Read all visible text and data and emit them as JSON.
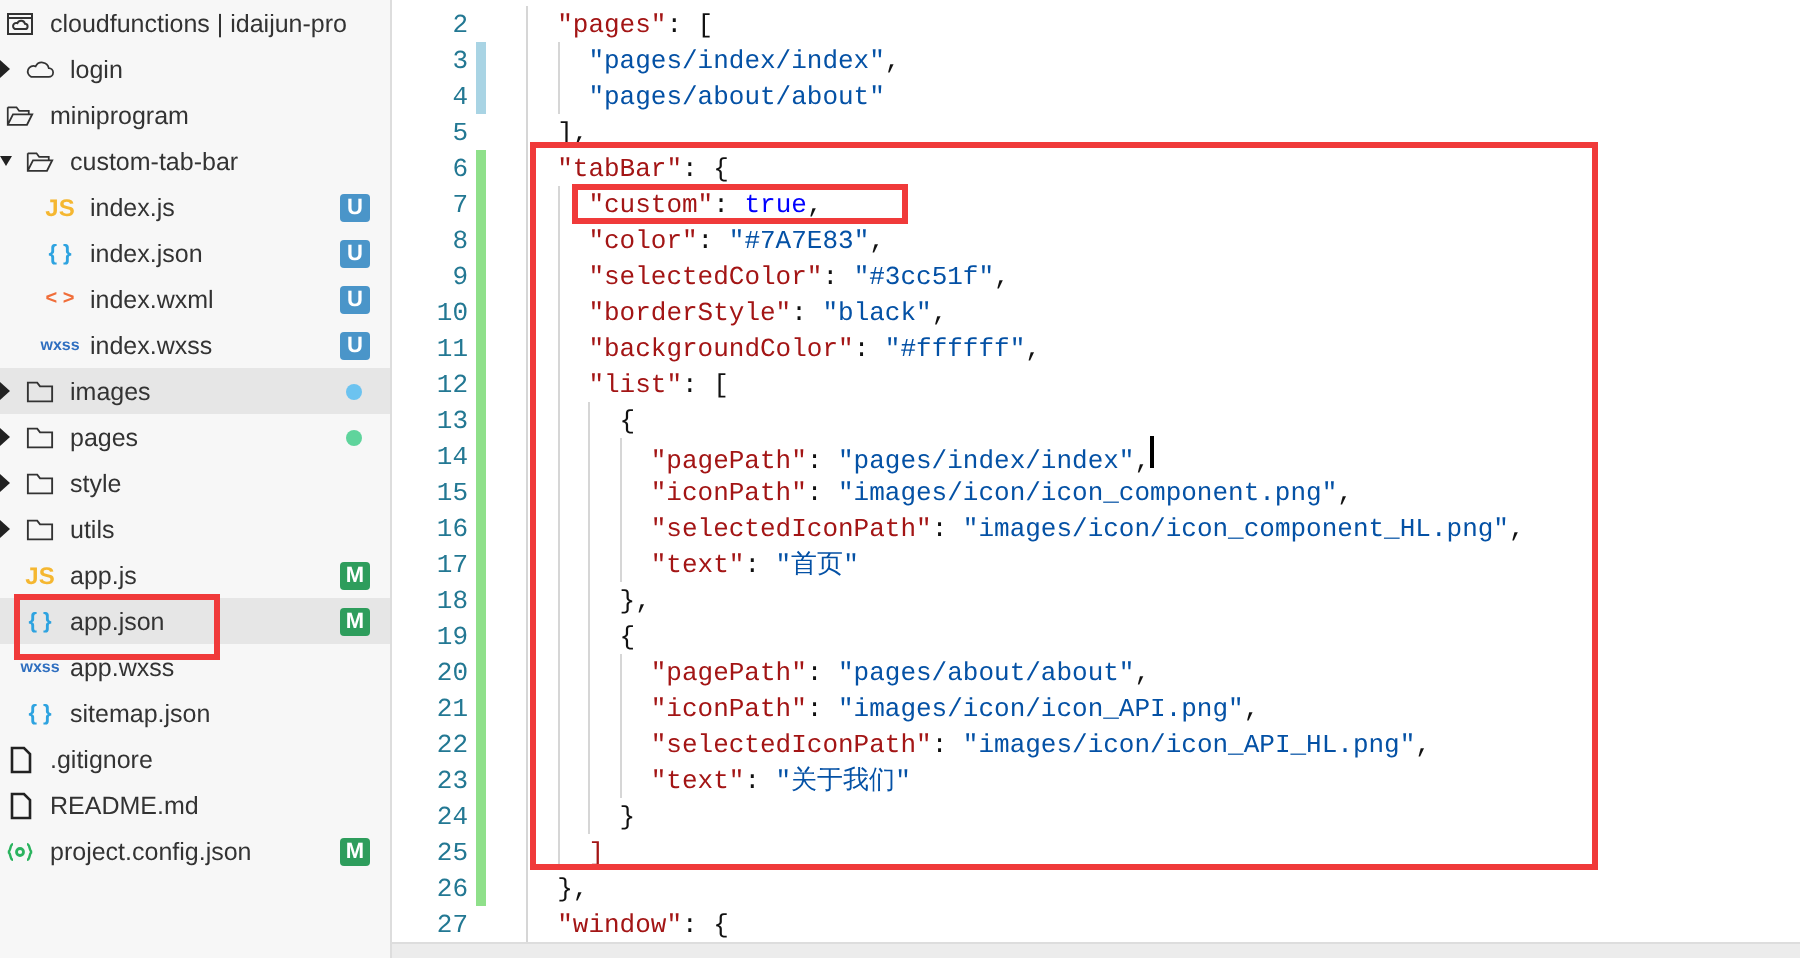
{
  "sidebar": {
    "items": [
      {
        "label": "cloudfunctions | idaijun-pro",
        "icon": {
          "kind": "cloud-folder"
        },
        "selected": false,
        "children": [
          {
            "label": "login",
            "icon": {
              "kind": "cloud"
            },
            "expanded": false,
            "selected": false
          }
        ]
      },
      {
        "label": "miniprogram",
        "icon": {
          "kind": "folder-open"
        },
        "selected": false,
        "children": [
          {
            "label": "custom-tab-bar",
            "icon": {
              "kind": "folder-open"
            },
            "expanded": true,
            "selected": false,
            "children": [
              {
                "label": "index.js",
                "icon": {
                  "kind": "js",
                  "text": "JS"
                },
                "selected": false,
                "status": {
                  "kind": "letter",
                  "text": "U",
                  "color": "#4a95c9"
                }
              },
              {
                "label": "index.json",
                "icon": {
                  "kind": "json",
                  "text": "{ }"
                },
                "selected": false,
                "status": {
                  "kind": "letter",
                  "text": "U",
                  "color": "#4a95c9"
                }
              },
              {
                "label": "index.wxml",
                "icon": {
                  "kind": "wxml",
                  "text": "< >"
                },
                "selected": false,
                "status": {
                  "kind": "letter",
                  "text": "U",
                  "color": "#4a95c9"
                }
              },
              {
                "label": "index.wxss",
                "icon": {
                  "kind": "wxss",
                  "text": "wxss"
                },
                "selected": false,
                "status": {
                  "kind": "letter",
                  "text": "U",
                  "color": "#4a95c9"
                }
              }
            ]
          },
          {
            "label": "images",
            "icon": {
              "kind": "folder"
            },
            "expanded": false,
            "selected": true,
            "status": {
              "kind": "dot",
              "color": "#6cc3f0"
            }
          },
          {
            "label": "pages",
            "icon": {
              "kind": "folder"
            },
            "expanded": false,
            "selected": false,
            "status": {
              "kind": "dot",
              "color": "#5fd49c"
            }
          },
          {
            "label": "style",
            "icon": {
              "kind": "folder"
            },
            "expanded": false,
            "selected": false
          },
          {
            "label": "utils",
            "icon": {
              "kind": "folder"
            },
            "expanded": false,
            "selected": false
          },
          {
            "label": "app.js",
            "icon": {
              "kind": "js",
              "text": "JS"
            },
            "selected": false,
            "status": {
              "kind": "letter",
              "text": "M",
              "color": "#2e9d5c"
            }
          },
          {
            "label": "app.json",
            "icon": {
              "kind": "json",
              "text": "{ }"
            },
            "selected": true,
            "marked": true,
            "status": {
              "kind": "letter",
              "text": "M",
              "color": "#2e9d5c"
            }
          },
          {
            "label": "app.wxss",
            "icon": {
              "kind": "wxss",
              "text": "wxss"
            },
            "selected": false
          },
          {
            "label": "sitemap.json",
            "icon": {
              "kind": "json",
              "text": "{ }"
            },
            "selected": false
          }
        ]
      },
      {
        "label": ".gitignore",
        "icon": {
          "kind": "file"
        },
        "selected": false
      },
      {
        "label": "README.md",
        "icon": {
          "kind": "file"
        },
        "selected": false
      },
      {
        "label": "project.config.json",
        "icon": {
          "kind": "config"
        },
        "selected": false,
        "status": {
          "kind": "letter",
          "text": "M",
          "color": "#2e9d5c"
        }
      }
    ]
  },
  "editor": {
    "lines": [
      {
        "number": "2",
        "boxed": false,
        "marked": false,
        "cursor": false,
        "tokens": [
          {
            "kind": "key",
            "text": "\"pages\""
          },
          {
            "kind": "punct",
            "text": ": ["
          }
        ],
        "children": [
          {
            "number": "3",
            "change": {
              "kind": "modified"
            },
            "boxed": false,
            "marked": false,
            "cursor": false,
            "tokens": [
              {
                "kind": "str",
                "text": "\"pages/index/index\""
              },
              {
                "kind": "punct",
                "text": ","
              }
            ]
          },
          {
            "number": "4",
            "change": {
              "kind": "modified"
            },
            "boxed": false,
            "marked": false,
            "cursor": false,
            "tokens": [
              {
                "kind": "str",
                "text": "\"pages/about/about\""
              }
            ]
          }
        ]
      },
      {
        "number": "5",
        "boxed": false,
        "marked": false,
        "cursor": false,
        "tokens": [
          {
            "kind": "punct",
            "text": "],"
          }
        ]
      },
      {
        "number": "6",
        "change": {
          "kind": "added"
        },
        "boxed": true,
        "marked": false,
        "cursor": false,
        "tokens": [
          {
            "kind": "key",
            "text": "\"tabBar\""
          },
          {
            "kind": "punct",
            "text": ": {"
          }
        ],
        "children": [
          {
            "number": "7",
            "change": {
              "kind": "added"
            },
            "boxed": false,
            "marked": true,
            "cursor": false,
            "tokens": [
              {
                "kind": "key",
                "text": "\"custom\""
              },
              {
                "kind": "punct",
                "text": ": "
              },
              {
                "kind": "kw",
                "text": "true"
              },
              {
                "kind": "punct",
                "text": ","
              }
            ]
          },
          {
            "number": "8",
            "change": {
              "kind": "added"
            },
            "boxed": false,
            "marked": false,
            "cursor": false,
            "tokens": [
              {
                "kind": "key",
                "text": "\"color\""
              },
              {
                "kind": "punct",
                "text": ": "
              },
              {
                "kind": "str",
                "text": "\"#7A7E83\""
              },
              {
                "kind": "punct",
                "text": ","
              }
            ]
          },
          {
            "number": "9",
            "change": {
              "kind": "added"
            },
            "boxed": false,
            "marked": false,
            "cursor": false,
            "tokens": [
              {
                "kind": "key",
                "text": "\"selectedColor\""
              },
              {
                "kind": "punct",
                "text": ": "
              },
              {
                "kind": "str",
                "text": "\"#3cc51f\""
              },
              {
                "kind": "punct",
                "text": ","
              }
            ]
          },
          {
            "number": "10",
            "change": {
              "kind": "added"
            },
            "boxed": false,
            "marked": false,
            "cursor": false,
            "tokens": [
              {
                "kind": "key",
                "text": "\"borderStyle\""
              },
              {
                "kind": "punct",
                "text": ": "
              },
              {
                "kind": "str",
                "text": "\"black\""
              },
              {
                "kind": "punct",
                "text": ","
              }
            ]
          },
          {
            "number": "11",
            "change": {
              "kind": "added"
            },
            "boxed": false,
            "marked": false,
            "cursor": false,
            "tokens": [
              {
                "kind": "key",
                "text": "\"backgroundColor\""
              },
              {
                "kind": "punct",
                "text": ": "
              },
              {
                "kind": "str",
                "text": "\"#ffffff\""
              },
              {
                "kind": "punct",
                "text": ","
              }
            ]
          },
          {
            "number": "12",
            "change": {
              "kind": "added"
            },
            "boxed": false,
            "marked": false,
            "cursor": false,
            "tokens": [
              {
                "kind": "key",
                "text": "\"list\""
              },
              {
                "kind": "punct",
                "text": ": ["
              }
            ],
            "children": [
              {
                "number": "13",
                "change": {
                  "kind": "added"
                },
                "boxed": false,
                "marked": false,
                "cursor": false,
                "tokens": [
                  {
                    "kind": "punct",
                    "text": "{"
                  }
                ],
                "children": [
                  {
                    "number": "14",
                    "change": {
                      "kind": "added"
                    },
                    "boxed": false,
                    "marked": false,
                    "cursor": true,
                    "tokens": [
                      {
                        "kind": "key",
                        "text": "\"pagePath\""
                      },
                      {
                        "kind": "punct",
                        "text": ": "
                      },
                      {
                        "kind": "str",
                        "text": "\"pages/index/index\""
                      },
                      {
                        "kind": "punct",
                        "text": ","
                      }
                    ]
                  },
                  {
                    "number": "15",
                    "change": {
                      "kind": "added"
                    },
                    "boxed": false,
                    "marked": false,
                    "cursor": false,
                    "tokens": [
                      {
                        "kind": "key",
                        "text": "\"iconPath\""
                      },
                      {
                        "kind": "punct",
                        "text": ": "
                      },
                      {
                        "kind": "str",
                        "text": "\"images/icon/icon_component.png\""
                      },
                      {
                        "kind": "punct",
                        "text": ","
                      }
                    ]
                  },
                  {
                    "number": "16",
                    "change": {
                      "kind": "added"
                    },
                    "boxed": false,
                    "marked": false,
                    "cursor": false,
                    "tokens": [
                      {
                        "kind": "key",
                        "text": "\"selectedIconPath\""
                      },
                      {
                        "kind": "punct",
                        "text": ": "
                      },
                      {
                        "kind": "str",
                        "text": "\"images/icon/icon_component_HL.png\""
                      },
                      {
                        "kind": "punct",
                        "text": ","
                      }
                    ]
                  },
                  {
                    "number": "17",
                    "change": {
                      "kind": "added"
                    },
                    "boxed": false,
                    "marked": false,
                    "cursor": false,
                    "tokens": [
                      {
                        "kind": "key",
                        "text": "\"text\""
                      },
                      {
                        "kind": "punct",
                        "text": ": "
                      },
                      {
                        "kind": "str",
                        "text": "\"首页\""
                      }
                    ]
                  }
                ]
              },
              {
                "number": "18",
                "change": {
                  "kind": "added"
                },
                "boxed": false,
                "marked": false,
                "cursor": false,
                "tokens": [
                  {
                    "kind": "punct",
                    "text": "},"
                  }
                ]
              },
              {
                "number": "19",
                "change": {
                  "kind": "added"
                },
                "boxed": false,
                "marked": false,
                "cursor": false,
                "tokens": [
                  {
                    "kind": "punct",
                    "text": "{"
                  }
                ],
                "children": [
                  {
                    "number": "20",
                    "change": {
                      "kind": "added"
                    },
                    "boxed": false,
                    "marked": false,
                    "cursor": false,
                    "tokens": [
                      {
                        "kind": "key",
                        "text": "\"pagePath\""
                      },
                      {
                        "kind": "punct",
                        "text": ": "
                      },
                      {
                        "kind": "str",
                        "text": "\"pages/about/about\""
                      },
                      {
                        "kind": "punct",
                        "text": ","
                      }
                    ]
                  },
                  {
                    "number": "21",
                    "change": {
                      "kind": "added"
                    },
                    "boxed": false,
                    "marked": false,
                    "cursor": false,
                    "tokens": [
                      {
                        "kind": "key",
                        "text": "\"iconPath\""
                      },
                      {
                        "kind": "punct",
                        "text": ": "
                      },
                      {
                        "kind": "str",
                        "text": "\"images/icon/icon_API.png\""
                      },
                      {
                        "kind": "punct",
                        "text": ","
                      }
                    ]
                  },
                  {
                    "number": "22",
                    "change": {
                      "kind": "added"
                    },
                    "boxed": false,
                    "marked": false,
                    "cursor": false,
                    "tokens": [
                      {
                        "kind": "key",
                        "text": "\"selectedIconPath\""
                      },
                      {
                        "kind": "punct",
                        "text": ": "
                      },
                      {
                        "kind": "str",
                        "text": "\"images/icon/icon_API_HL.png\""
                      },
                      {
                        "kind": "punct",
                        "text": ","
                      }
                    ]
                  },
                  {
                    "number": "23",
                    "change": {
                      "kind": "added"
                    },
                    "boxed": false,
                    "marked": false,
                    "cursor": false,
                    "tokens": [
                      {
                        "kind": "key",
                        "text": "\"text\""
                      },
                      {
                        "kind": "punct",
                        "text": ": "
                      },
                      {
                        "kind": "str",
                        "text": "\"关于我们\""
                      }
                    ]
                  }
                ]
              },
              {
                "number": "24",
                "change": {
                  "kind": "added"
                },
                "boxed": false,
                "marked": false,
                "cursor": false,
                "tokens": [
                  {
                    "kind": "punct",
                    "text": "}"
                  }
                ]
              }
            ]
          },
          {
            "number": "25",
            "change": {
              "kind": "added"
            },
            "boxed": false,
            "marked": false,
            "cursor": false,
            "tokens": [
              {
                "kind": "bracket",
                "text": "]"
              }
            ]
          }
        ]
      },
      {
        "number": "26",
        "change": {
          "kind": "added"
        },
        "boxed": false,
        "marked": false,
        "cursor": false,
        "tokens": [
          {
            "kind": "punct",
            "text": "},"
          }
        ]
      },
      {
        "number": "27",
        "boxed": false,
        "marked": false,
        "cursor": false,
        "tokens": [
          {
            "kind": "key",
            "text": "\"window\""
          },
          {
            "kind": "punct",
            "text": ": {"
          }
        ]
      }
    ]
  }
}
